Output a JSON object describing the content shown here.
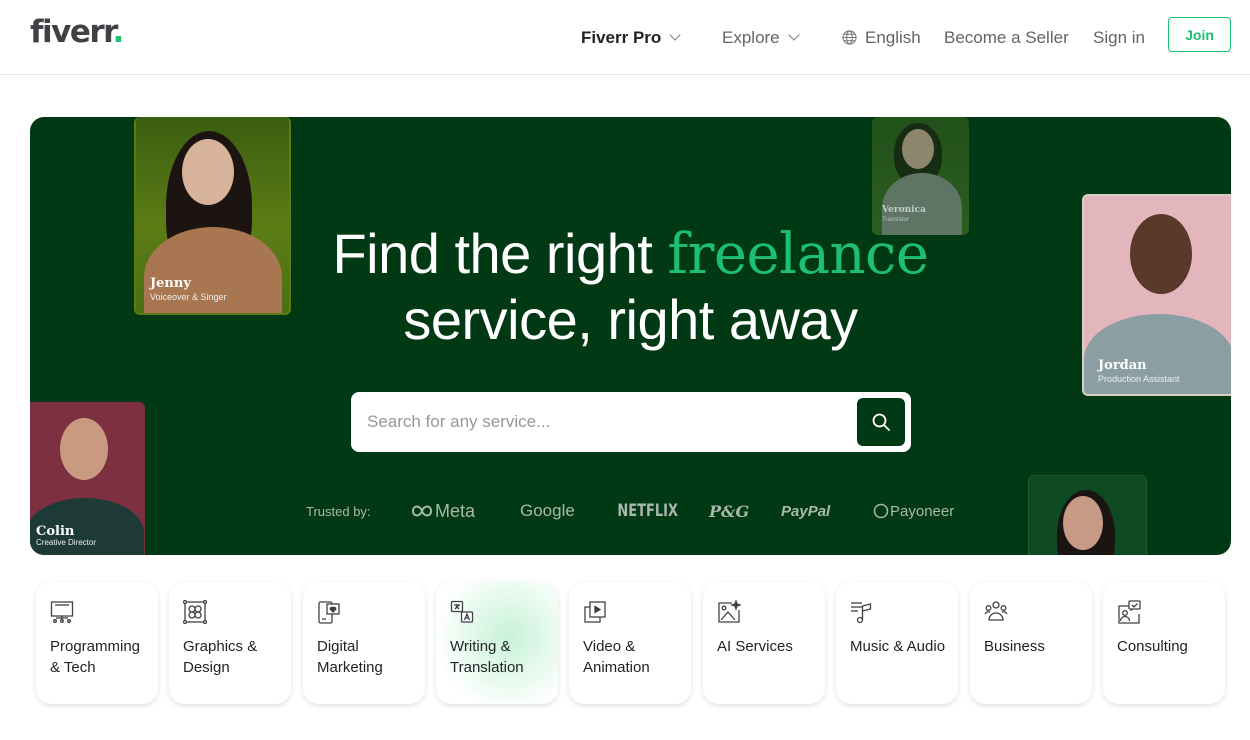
{
  "header": {
    "logo_text": "fiverr",
    "logo_dot": ".",
    "nav": {
      "fiverr_pro": "Fiverr Pro",
      "explore": "Explore",
      "language": "English",
      "become_seller": "Become a Seller",
      "sign_in": "Sign in",
      "join": "Join"
    }
  },
  "hero": {
    "headline_part1": "Find the right",
    "headline_accent": "freelance",
    "headline_part2": "service, right away",
    "search": {
      "placeholder": "Search for any service...",
      "value": ""
    },
    "trusted_label": "Trusted by:",
    "trusted_logos": [
      "Meta",
      "Google",
      "NETFLIX",
      "P&G",
      "PayPal",
      "Payoneer"
    ],
    "freelancers": [
      {
        "name": "Jenny",
        "role": "Voiceover & Singer"
      },
      {
        "name": "Veronica",
        "role": "Translator"
      },
      {
        "name": "Jordan",
        "role": "Production Assistant"
      },
      {
        "name": "Colin",
        "role": "Creative Director"
      }
    ]
  },
  "categories": [
    {
      "label": "Programming & Tech",
      "icon": "monitor-code-icon"
    },
    {
      "label": "Graphics & Design",
      "icon": "design-frame-icon"
    },
    {
      "label": "Digital Marketing",
      "icon": "phone-heart-icon"
    },
    {
      "label": "Writing & Translation",
      "icon": "translate-icon"
    },
    {
      "label": "Video & Animation",
      "icon": "video-play-icon"
    },
    {
      "label": "AI Services",
      "icon": "ai-image-icon"
    },
    {
      "label": "Music & Audio",
      "icon": "music-note-icon"
    },
    {
      "label": "Business",
      "icon": "people-group-icon"
    },
    {
      "label": "Consulting",
      "icon": "consulting-chat-icon"
    }
  ],
  "colors": {
    "brand_green": "#1dbf73",
    "hero_bg": "#013914",
    "text_dark": "#404145"
  }
}
